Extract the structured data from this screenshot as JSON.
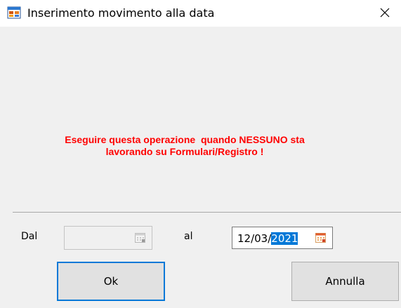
{
  "window": {
    "title": "Inserimento movimento alla data",
    "close_glyph": "✕",
    "icon": "app-window-icon"
  },
  "warning": {
    "line1": "Eseguire questa operazione  quando NESSUNO sta",
    "line2": "lavorando su Formulari/Registro !",
    "color": "#ff0000"
  },
  "form": {
    "from_label": "Dal",
    "from_value": "",
    "to_label": "al",
    "to_value_prefix": "12/03/",
    "to_value_selected": "2021",
    "calendar_icon": "calendar-icon"
  },
  "buttons": {
    "ok_label": "Ok",
    "cancel_label": "Annulla"
  },
  "colors": {
    "accent": "#0078d7",
    "background": "#f0f0f0"
  }
}
